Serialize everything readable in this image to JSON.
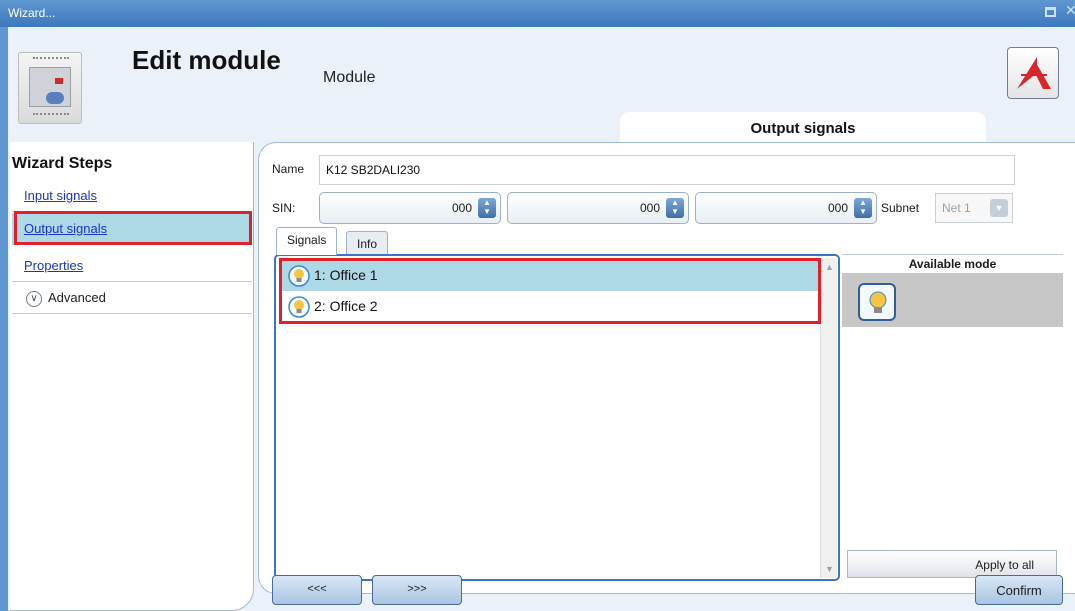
{
  "window": {
    "title": "Wizard..."
  },
  "header": {
    "title": "Edit module",
    "subtitle": "Module",
    "section": "Output signals"
  },
  "sidebar": {
    "title": "Wizard Steps",
    "items": [
      {
        "label": "Input signals"
      },
      {
        "label": "Output signals",
        "selected": true
      },
      {
        "label": "Properties"
      },
      {
        "label": "Advanced"
      }
    ]
  },
  "form": {
    "name_label": "Name",
    "name_value": "K12 SB2DALI230",
    "sin_label": "SIN:",
    "sin_values": [
      "000",
      "000",
      "000"
    ],
    "subnet_label": "Subnet",
    "subnet_value": "Net 1"
  },
  "tabs": [
    {
      "label": "Signals",
      "active": true
    },
    {
      "label": "Info"
    }
  ],
  "signals": [
    {
      "label": "1: Office 1",
      "selected": true
    },
    {
      "label": "2: Office 2"
    }
  ],
  "mode_panel": {
    "title": "Available mode",
    "apply_label": "Apply to all"
  },
  "nav": {
    "prev_label": "<<<",
    "next_label": ">>>",
    "confirm_label": "Confirm"
  },
  "colors": {
    "accent": "#3d78bd",
    "selection": "#add8e6",
    "highlight": "#e0202a"
  },
  "icons": [
    "maximize-icon",
    "close-icon",
    "module-image",
    "logo-icon",
    "chevron-down-icon",
    "bulb-icon"
  ]
}
